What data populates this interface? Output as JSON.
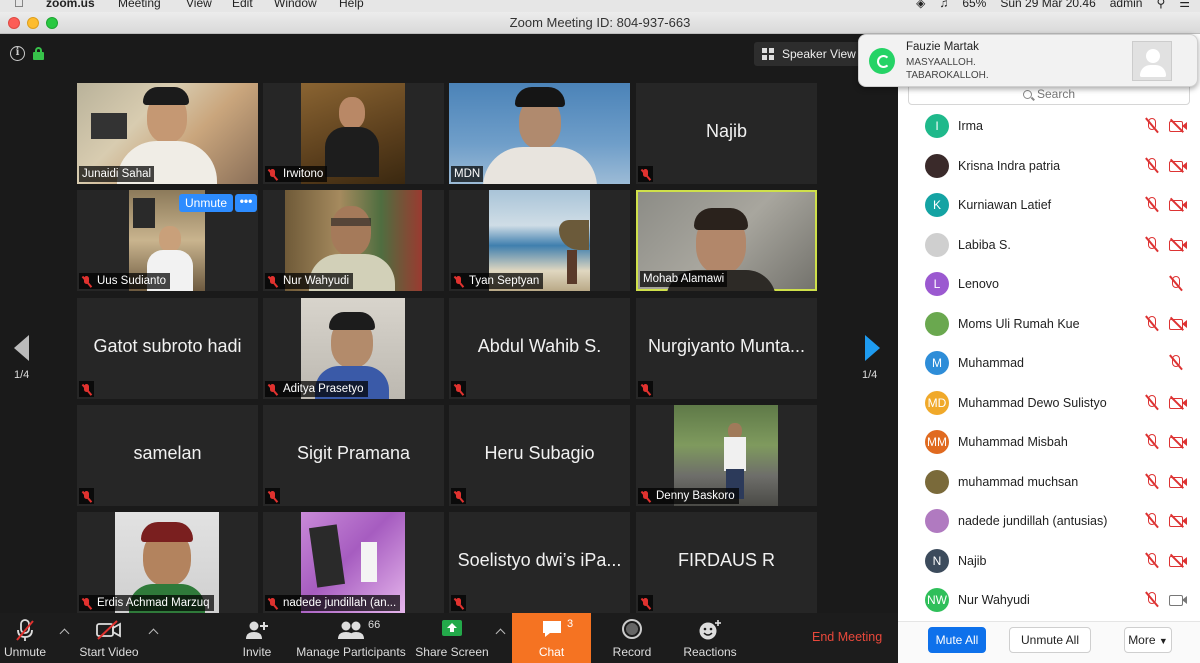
{
  "menubar": {
    "app": "zoom.us",
    "items": [
      "Meeting",
      "View",
      "Edit",
      "Window",
      "Help"
    ],
    "battery": "65%",
    "clock": "Sun 29 Mar  20.46",
    "user": "admin"
  },
  "window": {
    "title": "Zoom Meeting ID: 804-937-663"
  },
  "stage": {
    "speaker_view": "Speaker View",
    "page_left": "1/4",
    "page_right": "1/4",
    "unmute_pill": "Unmute",
    "more_pill": "•••"
  },
  "tiles": [
    {
      "name": "Junaidi Sahal",
      "video": true,
      "muted": false
    },
    {
      "name": "Irwitono",
      "video": true,
      "muted": true
    },
    {
      "name": "MDN",
      "video": true,
      "muted": false
    },
    {
      "name": "Najib",
      "video": false,
      "muted": true
    },
    {
      "name": "Uus Sudianto",
      "video": true,
      "muted": true
    },
    {
      "name": "Nur Wahyudi",
      "video": true,
      "muted": true
    },
    {
      "name": "Tyan Septyan",
      "video": true,
      "muted": true
    },
    {
      "name": "Mohab Alamawi",
      "video": true,
      "muted": false
    },
    {
      "name": "Gatot subroto hadi",
      "video": false,
      "muted": true
    },
    {
      "name": "Aditya Prasetyo",
      "video": true,
      "muted": true
    },
    {
      "name": "Abdul Wahib S.",
      "video": false,
      "muted": true
    },
    {
      "name": "Nurgiyanto Munta...",
      "video": false,
      "muted": true
    },
    {
      "name": "samelan",
      "video": false,
      "muted": true
    },
    {
      "name": "Sigit Pramana",
      "video": false,
      "muted": true
    },
    {
      "name": "Heru Subagio",
      "video": false,
      "muted": true
    },
    {
      "name": "Denny Baskoro",
      "video": true,
      "muted": true
    },
    {
      "name": "Erdis Achmad Marzuq",
      "video": true,
      "muted": true
    },
    {
      "name": "nadede jundillah (an...",
      "video": true,
      "muted": true
    },
    {
      "name": "Soelistyo dwi’s iPa...",
      "video": false,
      "muted": true
    },
    {
      "name": "FIRDAUS R",
      "video": false,
      "muted": true
    }
  ],
  "notification": {
    "from": "Fauzie Martak",
    "line1": "MASYAALLOH.",
    "line2": "TABAROKALLOH."
  },
  "panel": {
    "search_placeholder": "Search",
    "participants": [
      {
        "name": "Irma",
        "initials": "I",
        "color": "#1fb98b",
        "cam": "off"
      },
      {
        "name": "Krisna Indra patria",
        "initials": "",
        "color": "#3a2a2a",
        "cam": "off"
      },
      {
        "name": "Kurniawan Latief",
        "initials": "K",
        "color": "#14a3a3",
        "cam": "off"
      },
      {
        "name": "Labiba S.",
        "initials": "",
        "color": "#cfcfcf",
        "cam": "off"
      },
      {
        "name": "Lenovo",
        "initials": "L",
        "color": "#9b59d0",
        "cam": "none"
      },
      {
        "name": "Moms Uli Rumah Kue",
        "initials": "",
        "color": "#6aa84f",
        "cam": "off"
      },
      {
        "name": "Muhammad",
        "initials": "M",
        "color": "#2e8dd8",
        "cam": "none"
      },
      {
        "name": "Muhammad Dewo Sulistyo",
        "initials": "MD",
        "color": "#f0a92a",
        "cam": "off"
      },
      {
        "name": "Muhammad Misbah",
        "initials": "MM",
        "color": "#e06a20",
        "cam": "off"
      },
      {
        "name": "muhammad muchsan",
        "initials": "",
        "color": "#7a6a3a",
        "cam": "off"
      },
      {
        "name": "nadede jundillah (antusias)",
        "initials": "",
        "color": "#b07ac0",
        "cam": "off"
      },
      {
        "name": "Najib",
        "initials": "N",
        "color": "#3c4b5c",
        "cam": "off"
      },
      {
        "name": "Nur Wahyudi",
        "initials": "NW",
        "color": "#2fbf5a",
        "cam": "on"
      }
    ],
    "mute_all": "Mute All",
    "unmute_all": "Unmute All",
    "more": "More"
  },
  "toolbar": {
    "unmute": "Unmute",
    "start_video": "Start Video",
    "invite": "Invite",
    "manage_participants": "Manage Participants",
    "participant_count": "66",
    "share_screen": "Share Screen",
    "chat": "Chat",
    "chat_count": "3",
    "record": "Record",
    "reactions": "Reactions",
    "end_meeting": "End Meeting"
  }
}
